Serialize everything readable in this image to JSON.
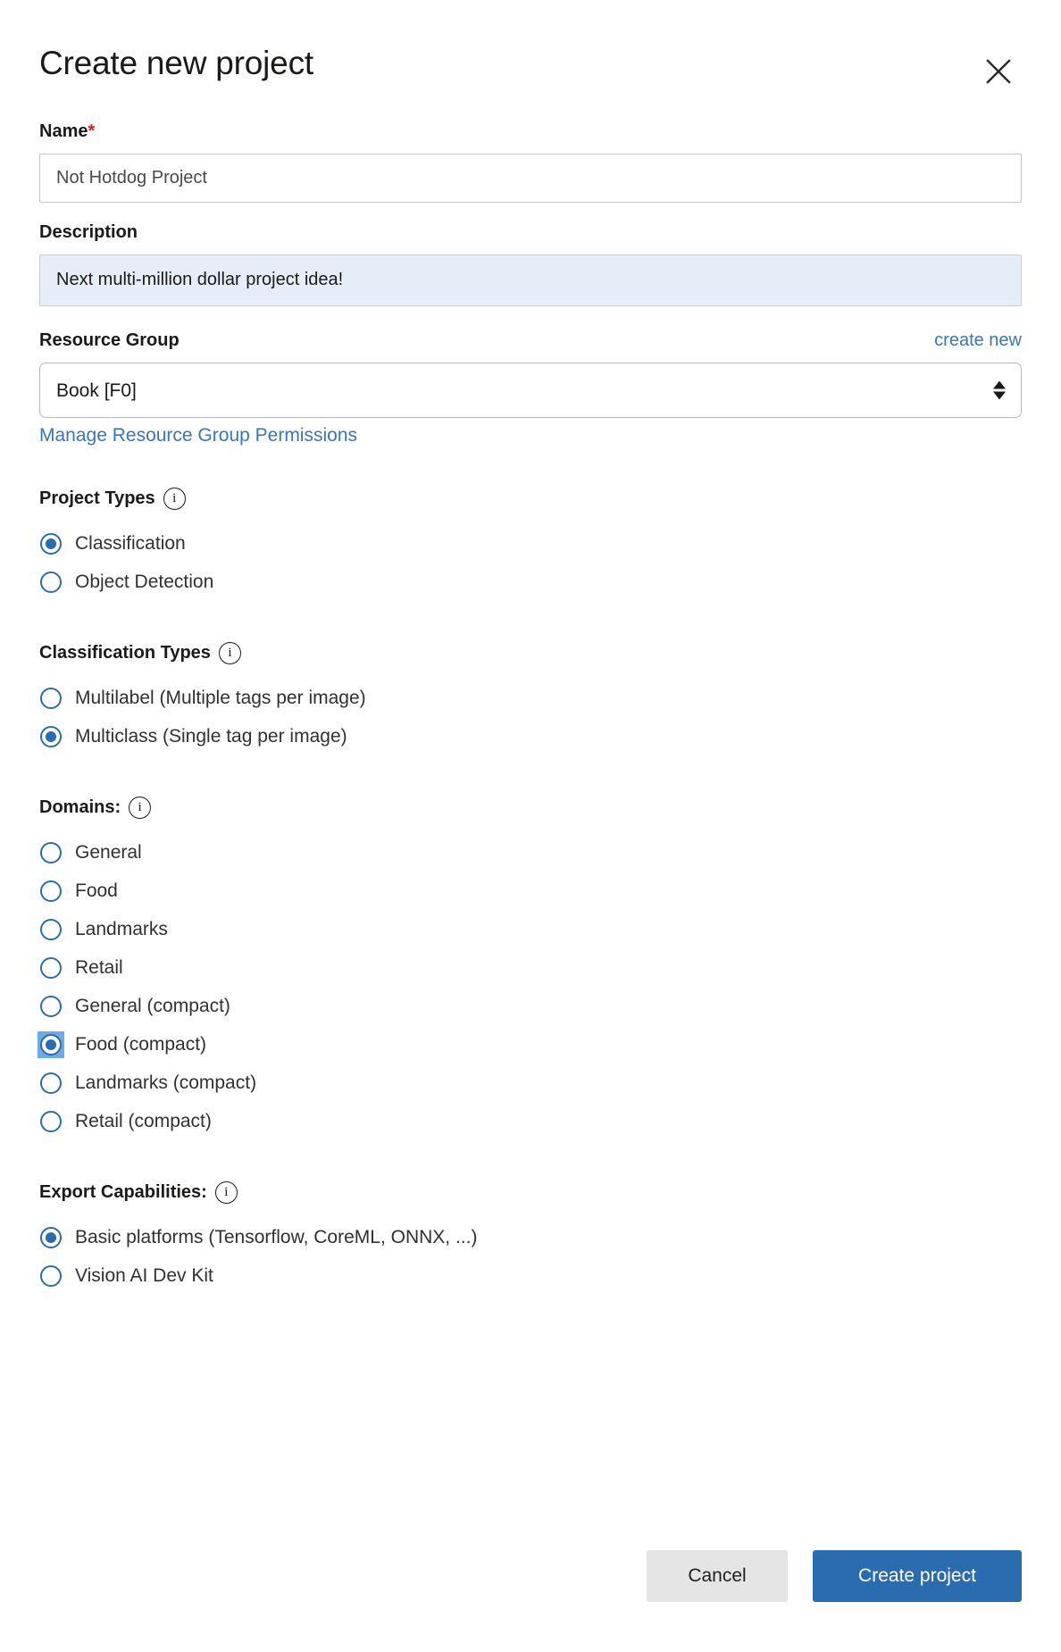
{
  "dialog": {
    "title": "Create new project",
    "close_icon": "close-icon"
  },
  "name_field": {
    "label": "Name",
    "required_mark": "*",
    "value": "Not Hotdog Project",
    "placeholder": "Not Hotdog Project"
  },
  "description_field": {
    "label": "Description",
    "value": "Next multi-million dollar project idea!",
    "placeholder": "Next multi-million dollar project idea!"
  },
  "resource_group": {
    "label": "Resource Group",
    "create_new_label": "create new",
    "selected": "Book [F0]",
    "options": [
      "Book [F0]"
    ],
    "manage_link": "Manage Resource Group Permissions"
  },
  "project_types": {
    "heading": "Project Types",
    "info_glyph": "i",
    "options": [
      {
        "label": "Classification",
        "checked": true,
        "focused": false
      },
      {
        "label": "Object Detection",
        "checked": false,
        "focused": false
      }
    ]
  },
  "classification_types": {
    "heading": "Classification Types",
    "info_glyph": "i",
    "options": [
      {
        "label": "Multilabel (Multiple tags per image)",
        "checked": false,
        "focused": false
      },
      {
        "label": "Multiclass (Single tag per image)",
        "checked": true,
        "focused": false
      }
    ]
  },
  "domains": {
    "heading": "Domains:",
    "info_glyph": "i",
    "options": [
      {
        "label": "General",
        "checked": false,
        "focused": false
      },
      {
        "label": "Food",
        "checked": false,
        "focused": false
      },
      {
        "label": "Landmarks",
        "checked": false,
        "focused": false
      },
      {
        "label": "Retail",
        "checked": false,
        "focused": false
      },
      {
        "label": "General (compact)",
        "checked": false,
        "focused": false
      },
      {
        "label": "Food (compact)",
        "checked": true,
        "focused": true
      },
      {
        "label": "Landmarks (compact)",
        "checked": false,
        "focused": false
      },
      {
        "label": "Retail (compact)",
        "checked": false,
        "focused": false
      }
    ]
  },
  "export_capabilities": {
    "heading": "Export Capabilities:",
    "info_glyph": "i",
    "options": [
      {
        "label": "Basic platforms (Tensorflow, CoreML, ONNX, ...)",
        "checked": true,
        "focused": false
      },
      {
        "label": "Vision AI Dev Kit",
        "checked": false,
        "focused": false
      }
    ]
  },
  "footer": {
    "cancel_label": "Cancel",
    "create_label": "Create project"
  },
  "colors": {
    "accent": "#2b6cb0",
    "link": "#3a76bd",
    "required": "#e02020",
    "focus_highlight": "#6cabe4",
    "textarea_focus_bg": "#e6edf8",
    "cancel_bg": "#e5e5e5"
  }
}
